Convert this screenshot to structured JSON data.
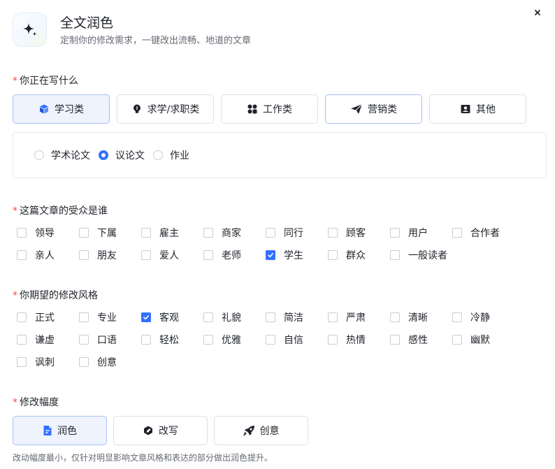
{
  "header": {
    "title": "全文润色",
    "subtitle": "定制你的修改需求，一键改出流畅、地道的文章",
    "icon": "sparkles-icon"
  },
  "accent_color": "#3370ff",
  "required_mark": "*",
  "section_type": {
    "label": "你正在写什么",
    "categories": [
      {
        "label": "学习类",
        "icon": "cube-icon",
        "selected": true
      },
      {
        "label": "求学/求职类",
        "icon": "lightbulb-icon",
        "selected": false
      },
      {
        "label": "工作类",
        "icon": "apps-icon",
        "selected": false
      },
      {
        "label": "营销类",
        "icon": "paper-plane-icon",
        "selected": false
      },
      {
        "label": "其他",
        "icon": "profile-card-icon",
        "selected": false
      }
    ],
    "subtypes": [
      {
        "label": "学术论文",
        "checked": false
      },
      {
        "label": "议论文",
        "checked": true
      },
      {
        "label": "作业",
        "checked": false
      }
    ]
  },
  "section_audience": {
    "label": "这篇文章的受众是谁",
    "rows": [
      [
        {
          "label": "领导",
          "checked": false
        },
        {
          "label": "下属",
          "checked": false
        },
        {
          "label": "雇主",
          "checked": false
        },
        {
          "label": "商家",
          "checked": false
        },
        {
          "label": "同行",
          "checked": false
        },
        {
          "label": "顾客",
          "checked": false
        },
        {
          "label": "用户",
          "checked": false
        },
        {
          "label": "合作者",
          "checked": false
        }
      ],
      [
        {
          "label": "亲人",
          "checked": false
        },
        {
          "label": "朋友",
          "checked": false
        },
        {
          "label": "爱人",
          "checked": false
        },
        {
          "label": "老师",
          "checked": false
        },
        {
          "label": "学生",
          "checked": true
        },
        {
          "label": "群众",
          "checked": false
        },
        {
          "label": "一般读者",
          "checked": false
        }
      ]
    ]
  },
  "section_style": {
    "label": "你期望的修改风格",
    "rows": [
      [
        {
          "label": "正式",
          "checked": false
        },
        {
          "label": "专业",
          "checked": false
        },
        {
          "label": "客观",
          "checked": true
        },
        {
          "label": "礼貌",
          "checked": false
        },
        {
          "label": "简洁",
          "checked": false
        },
        {
          "label": "严肃",
          "checked": false
        },
        {
          "label": "清晰",
          "checked": false
        },
        {
          "label": "冷静",
          "checked": false
        }
      ],
      [
        {
          "label": "谦虚",
          "checked": false
        },
        {
          "label": "口语",
          "checked": false
        },
        {
          "label": "轻松",
          "checked": false
        },
        {
          "label": "优雅",
          "checked": false
        },
        {
          "label": "自信",
          "checked": false
        },
        {
          "label": "热情",
          "checked": false
        },
        {
          "label": "感性",
          "checked": false
        },
        {
          "label": "幽默",
          "checked": false
        }
      ],
      [
        {
          "label": "讽刺",
          "checked": false
        },
        {
          "label": "创意",
          "checked": false
        }
      ]
    ]
  },
  "section_degree": {
    "label": "修改幅度",
    "options": [
      {
        "label": "润色",
        "icon": "document-icon",
        "selected": true
      },
      {
        "label": "改写",
        "icon": "rewrite-icon",
        "selected": false
      },
      {
        "label": "创意",
        "icon": "rocket-icon",
        "selected": false
      }
    ],
    "hint": "改动幅度最小，仅针对明显影响文章风格和表达的部分做出润色提升。"
  }
}
